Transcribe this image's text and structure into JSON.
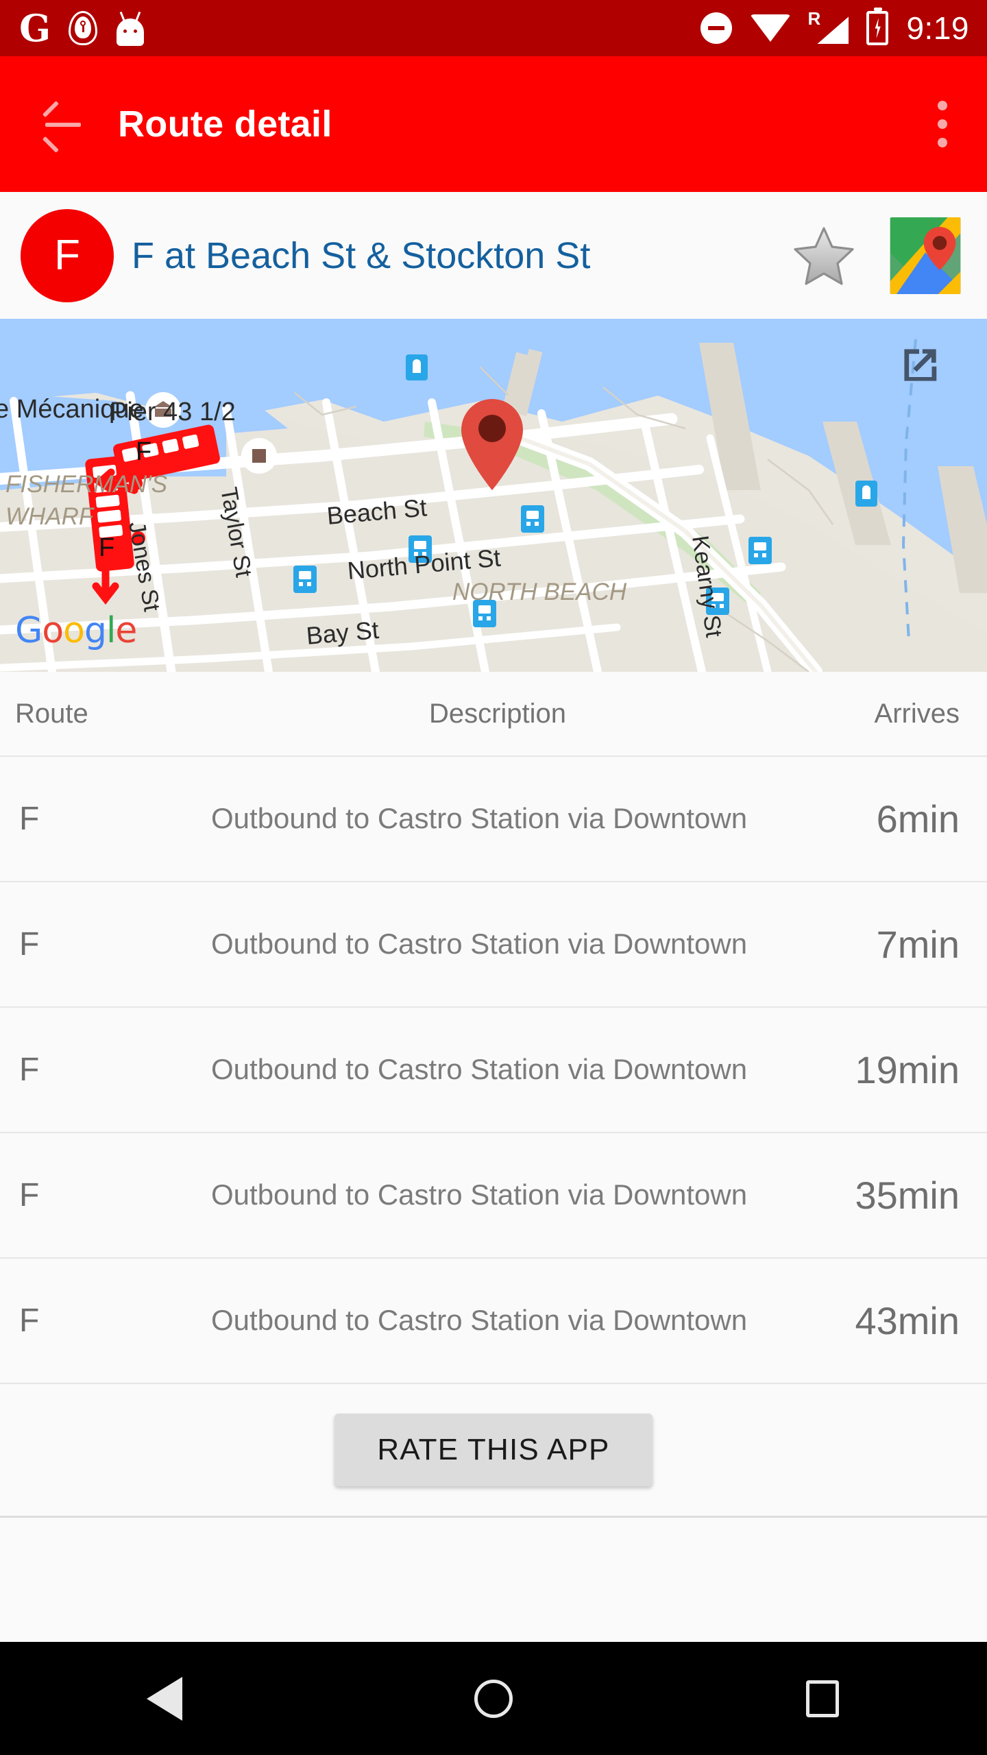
{
  "status_bar": {
    "time": "9:19",
    "icons": [
      "google-g-icon",
      "shield-vpn-icon",
      "android-head-icon",
      "do-not-disturb-icon",
      "wifi-icon",
      "cellular-signal-roaming-icon",
      "battery-charging-icon"
    ],
    "roaming_label": "R",
    "background_color": "#b00000"
  },
  "app_bar": {
    "title": "Route detail",
    "back_label": "Navigate up",
    "overflow_label": "More options",
    "background_color": "#ff0000",
    "title_color": "#ffffff"
  },
  "stop_header": {
    "route_badge": "F",
    "badge_color": "#f40000",
    "stop_name": "F at Beach St & Stockton St",
    "stop_name_color": "#15609e",
    "favorite_label": "Add to favorites",
    "favorite_state": "off",
    "maps_label": "Open in Google Maps"
  },
  "map": {
    "attribution": "Google",
    "attribution_letters": [
      "G",
      "o",
      "o",
      "g",
      "l",
      "e"
    ],
    "open_external_label": "Open map externally",
    "labels": [
      "e Mécanique",
      "Pier 43 1/2",
      "FISHERMAN'S",
      "WHARF",
      "Taylor St",
      "Jones St",
      "Beach St",
      "North Point St",
      "Bay St",
      "Kearny St",
      "NORTH BEACH"
    ],
    "marker_label": "Selected stop marker",
    "vehicle_label": "F",
    "water_color": "#a3ccff",
    "land_color": "#e8e5dd",
    "road_color": "#ffffff",
    "transit_icon_color": "#29a6e8"
  },
  "departures": {
    "columns": {
      "route": "Route",
      "description": "Description",
      "arrives": "Arrives"
    },
    "rows": [
      {
        "route": "F",
        "description": "Outbound to Castro Station via Downtown",
        "arrives": "6min"
      },
      {
        "route": "F",
        "description": "Outbound to Castro Station via Downtown",
        "arrives": "7min"
      },
      {
        "route": "F",
        "description": "Outbound to Castro Station via Downtown",
        "arrives": "19min"
      },
      {
        "route": "F",
        "description": "Outbound to Castro Station via Downtown",
        "arrives": "35min"
      },
      {
        "route": "F",
        "description": "Outbound to Castro Station via Downtown",
        "arrives": "43min"
      }
    ]
  },
  "rate": {
    "label": "RATE THIS APP"
  },
  "nav_bar": {
    "back": "Back",
    "home": "Home",
    "recents": "Recent apps",
    "background_color": "#000000"
  }
}
